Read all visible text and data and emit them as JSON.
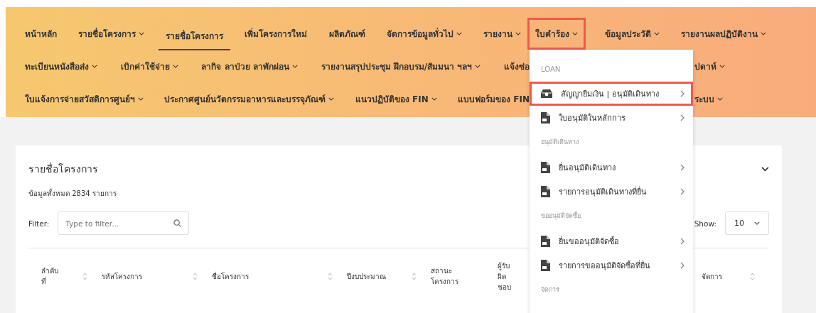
{
  "nav": {
    "rows": [
      {
        "left": [
          {
            "label": "หน้าหลัก",
            "dropdown": false,
            "selected": false,
            "highlighted": false
          },
          {
            "label": "รายชื่อโครงการ",
            "dropdown": true,
            "selected": false,
            "highlighted": false
          },
          {
            "label": "รายชื่อโครงการ",
            "dropdown": false,
            "selected": true,
            "highlighted": false
          },
          {
            "label": "เพิ่มโครงการใหม่",
            "dropdown": false,
            "selected": false,
            "highlighted": false
          },
          {
            "label": "ผลิตภัณฑ์",
            "dropdown": false,
            "selected": false,
            "highlighted": false
          },
          {
            "label": "จัดการข้อมูลทั่วไป",
            "dropdown": true,
            "selected": false,
            "highlighted": false
          },
          {
            "label": "รายงาน",
            "dropdown": true,
            "selected": false,
            "highlighted": false
          }
        ],
        "right": [
          {
            "label": "ใบคำร้อง",
            "dropdown": true,
            "selected": false,
            "highlighted": true,
            "menu": {
              "sections": [
                {
                  "header": "LOAN",
                  "items": [
                    {
                      "label": "สัญญายืมเงิน | อนุมัติเดินทาง",
                      "kind": "cash",
                      "highlighted": true
                    },
                    {
                      "label": "ใบอนุมัติในหลักการ",
                      "kind": "document",
                      "highlighted": false
                    }
                  ]
                },
                {
                  "header": "อนุมัติเดินทาง",
                  "items": [
                    {
                      "label": "ยื่นอนุมัติเดินทาง",
                      "kind": "document",
                      "highlighted": false
                    },
                    {
                      "label": "รายการอนุมัติเดินทางที่ยื่น",
                      "kind": "document",
                      "highlighted": false
                    }
                  ]
                },
                {
                  "header": "ขออนุมัติจัดซื้อ",
                  "items": [
                    {
                      "label": "ยื่นขออนุมัติจัดซื้อ",
                      "kind": "document",
                      "highlighted": false
                    },
                    {
                      "label": "รายการขออนุมัติจัดซื้อที่ยื่น",
                      "kind": "document",
                      "highlighted": false
                    }
                  ]
                },
                {
                  "header": "จัดการ"
                }
              ]
            }
          },
          {
            "label": "ข้อมูลประวัติ",
            "dropdown": true,
            "selected": false,
            "highlighted": false
          },
          {
            "label": "รายงานผลปฏิบัติงาน",
            "dropdown": true,
            "selected": false,
            "highlighted": false
          }
        ]
      },
      {
        "left": [
          {
            "label": "ทะเบียนหนังสือส่ง",
            "dropdown": true,
            "selected": false,
            "highlighted": false
          },
          {
            "label": "เบิกค่าใช้จ่าย",
            "dropdown": true,
            "selected": false,
            "highlighted": false
          },
          {
            "label": "ลากิจ ลาป่วย ลาพักผ่อน",
            "dropdown": true,
            "selected": false,
            "highlighted": false
          },
          {
            "label": "รายงานสรุปประชุม ฝึกอบรม/สัมมนา ฯลฯ",
            "dropdown": true,
            "selected": false,
            "highlighted": false
          },
          {
            "label": "แจ้งซ่อ",
            "dropdown": false,
            "selected": false,
            "highlighted": false
          }
        ],
        "right": [
          {
            "label": "ปดาห์",
            "dropdown": true,
            "selected": false,
            "highlighted": false
          }
        ]
      },
      {
        "left": [
          {
            "label": "ใบแจ้งการจ่ายสวัสดิการศูนย์ฯ",
            "dropdown": true,
            "selected": false,
            "highlighted": false
          },
          {
            "label": "ประกาศศูนย์นวัตกรรมอาหารและบรรจุภัณฑ์",
            "dropdown": true,
            "selected": false,
            "highlighted": false
          },
          {
            "label": "แนวปฏิบัติของ FIN",
            "dropdown": true,
            "selected": false,
            "highlighted": false
          },
          {
            "label": "แบบฟอร์มของ FIN",
            "dropdown": false,
            "selected": false,
            "highlighted": false
          }
        ],
        "right": [
          {
            "label": "ระบบ",
            "dropdown": true,
            "selected": false,
            "highlighted": false
          }
        ]
      }
    ]
  },
  "card": {
    "title": "รายชื่อโครงการ",
    "count": "ข้อมูลทั้งหมด 2834 รายการ",
    "filter": {
      "label": "Filter:",
      "placeholder": "Type to filter..."
    },
    "show": {
      "label": "Show:",
      "value": "10"
    },
    "columns": [
      {
        "label": "ลำดับที่",
        "sortable": true
      },
      {
        "label": "รหัสโครงการ",
        "sortable": true
      },
      {
        "label": "ชื่อโครงการ",
        "sortable": true
      },
      {
        "label": "ปีงบประมาณ",
        "sortable": true
      },
      {
        "label": "สถานะโครงการ",
        "sortable": false
      },
      {
        "label": "ผู้รับผิดชอบ",
        "sortable": false
      },
      {
        "label": "จัดการ",
        "sortable": true
      }
    ]
  }
}
